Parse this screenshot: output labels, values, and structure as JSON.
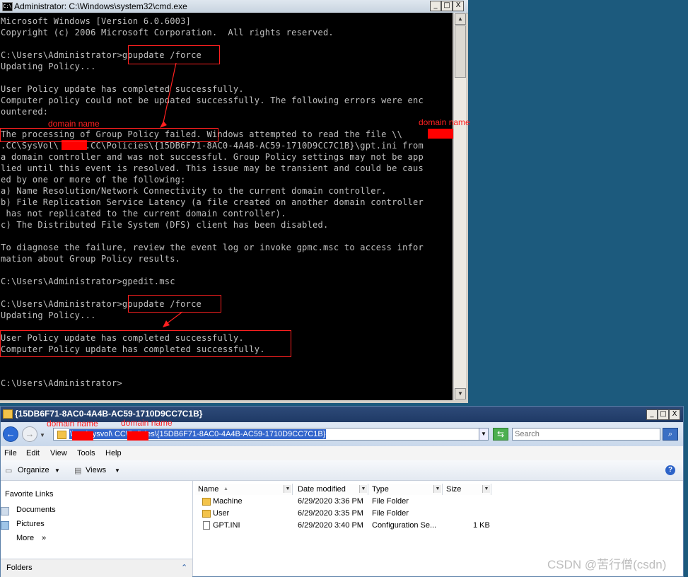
{
  "cmd_window": {
    "title": "Administrator: C:\\Windows\\system32\\cmd.exe",
    "icon_label": "C:\\",
    "lines": [
      "Microsoft Windows [Version 6.0.6003]",
      "Copyright (c) 2006 Microsoft Corporation.  All rights reserved.",
      "",
      "C:\\Users\\Administrator>gpupdate /force",
      "Updating Policy...",
      "",
      "User Policy update has completed successfully.",
      "Computer policy could not be updated successfully. The following errors were enc",
      "ountered:",
      "",
      "The processing of Group Policy failed. Windows attempted to read the file \\\\",
      ".CC\\SysVol\\     .CC\\Policies\\{15DB6F71-8AC0-4A4B-AC59-1710D9CC7C1B}\\gpt.ini from",
      "a domain controller and was not successful. Group Policy settings may not be app",
      "lied until this event is resolved. This issue may be transient and could be caus",
      "ed by one or more of the following:",
      "a) Name Resolution/Network Connectivity to the current domain controller.",
      "b) File Replication Service Latency (a file created on another domain controller",
      " has not replicated to the current domain controller).",
      "c) The Distributed File System (DFS) client has been disabled.",
      "",
      "To diagnose the failure, review the event log or invoke gpmc.msc to access infor",
      "mation about Group Policy results.",
      "",
      "C:\\Users\\Administrator>gpedit.msc",
      "",
      "C:\\Users\\Administrator>gpupdate /force",
      "Updating Policy...",
      "",
      "User Policy update has completed successfully.",
      "Computer Policy update has completed successfully.",
      "",
      "",
      "C:\\Users\\Administrator>"
    ],
    "buttons": {
      "minimize": "_",
      "maximize": "□",
      "close": "X"
    },
    "annotations": {
      "domain_label_1": "domain name",
      "domain_label_2": "domain name"
    }
  },
  "explorer_window": {
    "title": "{15DB6F71-8AC0-4A4B-AC59-1710D9CC7C1B}",
    "address": "\\\\      .cc\\sysvol\\      CC\\Policies\\{15DB6F71-8AC0-4A4B-AC59-1710D9CC7C1B}",
    "search_placeholder": "Search",
    "menu": [
      "File",
      "Edit",
      "View",
      "Tools",
      "Help"
    ],
    "toolbar": {
      "organize": "Organize",
      "views": "Views"
    },
    "nav": {
      "favorite_links": "Favorite Links",
      "items": [
        "Documents",
        "Pictures",
        "More"
      ],
      "more_chevron": "»",
      "folders": "Folders"
    },
    "columns": [
      "Name",
      "Date modified",
      "Type",
      "Size"
    ],
    "files": [
      {
        "name": "Machine",
        "date": "6/29/2020 3:36 PM",
        "type": "File Folder",
        "size": ""
      },
      {
        "name": "User",
        "date": "6/29/2020 3:35 PM",
        "type": "File Folder",
        "size": ""
      },
      {
        "name": "GPT.INI",
        "date": "6/29/2020 3:40 PM",
        "type": "Configuration Se...",
        "size": "1 KB"
      }
    ],
    "annotations": {
      "domain_label_1": "domain name",
      "domain_label_2": "domain name"
    }
  },
  "watermark": "CSDN @苦行僧(csdn)"
}
